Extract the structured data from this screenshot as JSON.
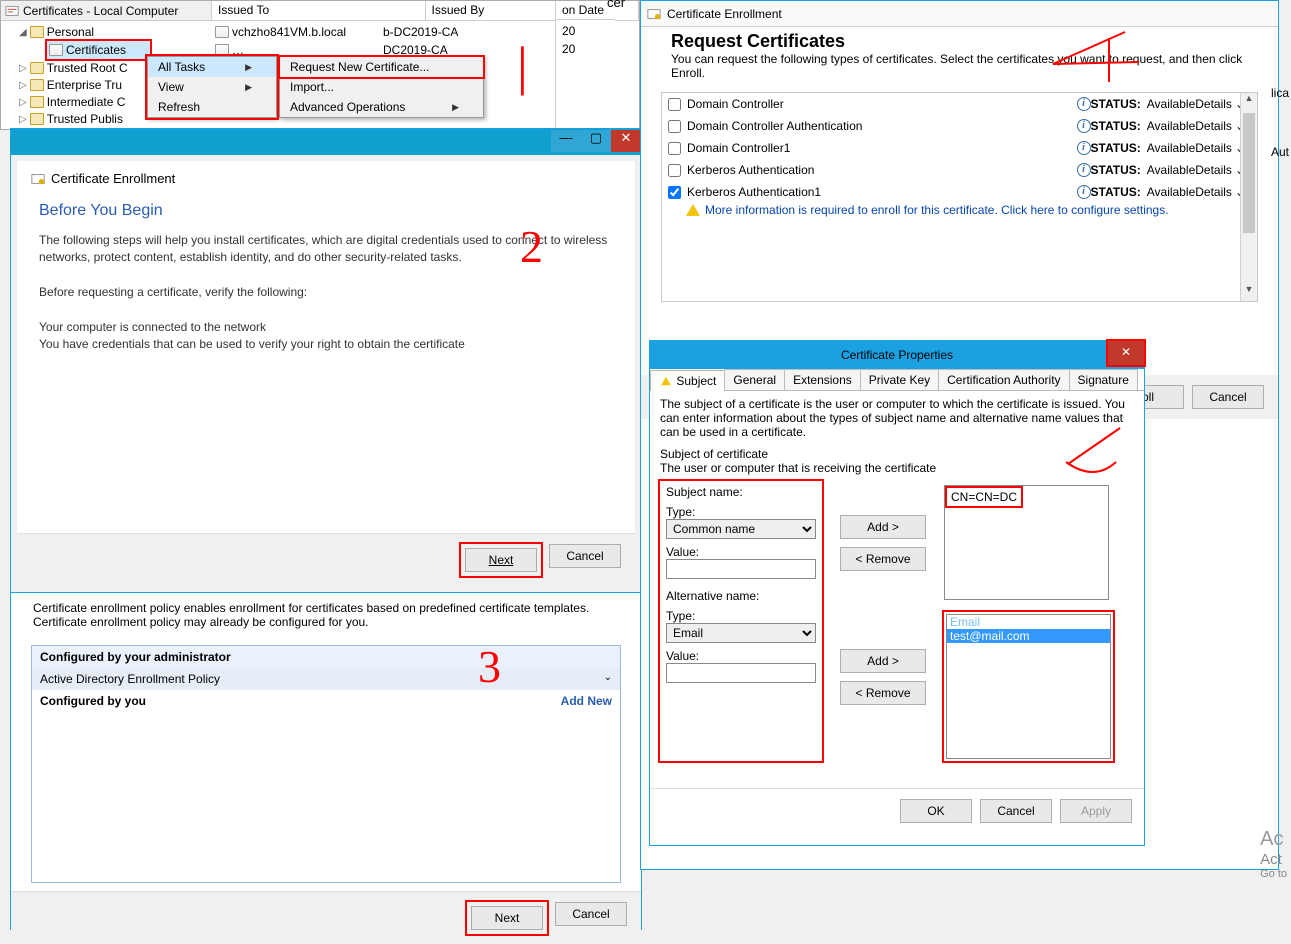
{
  "mmc": {
    "root": "Certificates - Local Computer",
    "personal": "Personal",
    "certificates_node": "Certificates",
    "trusted_root": "Trusted Root C",
    "enterprise": "Enterprise Tru",
    "intermediate": "Intermediate C",
    "trusted_publishers": "Trusted Publis",
    "cols": {
      "issued_to": "Issued To",
      "issued_by": "Issued By",
      "expiration": "on Date"
    },
    "rows": [
      {
        "to": "vchzho841VM.b.local",
        "by": "b-DC2019-CA",
        "exp": "20"
      },
      {
        "to": "…",
        "by": "DC2019-CA",
        "exp": "20"
      }
    ],
    "ctx1": {
      "all_tasks": "All Tasks",
      "view": "View",
      "refresh": "Refresh"
    },
    "ctx2": {
      "request_new": "Request New Certificate...",
      "import": "Import...",
      "advanced": "Advanced Operations"
    },
    "top_cut": "cer"
  },
  "wiz2": {
    "title": "Certificate Enrollment",
    "header": "Before You Begin",
    "p1": "The following steps will help you install certificates, which are digital credentials used to connect to wireless networks, protect content, establish identity, and do other security-related tasks.",
    "p2": "Before requesting a certificate, verify the following:",
    "p3": "Your computer is connected to the network",
    "p4": "You have credentials that can be used to verify your right to obtain the certificate",
    "next": "Next",
    "cancel": "Cancel"
  },
  "wiz3": {
    "intro": "Certificate enrollment policy enables enrollment for certificates based on predefined certificate templates. Certificate enrollment policy may already be configured for you.",
    "configured_admin": "Configured by your administrator",
    "ad_policy": "Active Directory Enrollment Policy",
    "configured_you": "Configured by you",
    "add_new": "Add New",
    "next": "Next",
    "cancel": "Cancel"
  },
  "wiz4": {
    "title": "Certificate Enrollment",
    "header": "Request Certificates",
    "desc": "You can request the following types of certificates. Select the certificates you want to request, and then click Enroll.",
    "status_label": "STATUS:",
    "available": "Available",
    "details": "Details",
    "templates": [
      {
        "name": "Domain Controller",
        "checked": false
      },
      {
        "name": "Domain Controller Authentication",
        "checked": false
      },
      {
        "name": "Domain Controller1",
        "checked": false
      },
      {
        "name": "Kerberos Authentication",
        "checked": false
      },
      {
        "name": "Kerberos Authentication1",
        "checked": true
      }
    ],
    "warn": "More information is required to enroll for this certificate. Click here to configure settings.",
    "enroll": "oll",
    "cancel": "Cancel"
  },
  "wiz5": {
    "title": "Certificate Properties",
    "tabs": [
      "Subject",
      "General",
      "Extensions",
      "Private Key",
      "Certification Authority",
      "Signature"
    ],
    "desc": "The subject of a certificate is the user or computer to which the certificate is issued. You can enter information about the types of subject name and alternative name values that can be used in a certificate.",
    "subj_of_cert": "Subject of certificate",
    "receiving": "The user or computer that is receiving the certificate",
    "subject_name": "Subject name:",
    "alt_name": "Alternative name:",
    "type": "Type:",
    "value": "Value:",
    "subj_type_sel": "Common name",
    "alt_type_sel": "Email",
    "add": "Add >",
    "remove": "< Remove",
    "subj_preview": "CN=CN=DC",
    "alt_preview_label": "Email",
    "alt_preview_value": "test@mail.com",
    "ok": "OK",
    "cancel": "Cancel",
    "apply": "Apply"
  },
  "side_cut": {
    "a": "lica",
    "b": "Aut"
  },
  "activate": {
    "l1": "Ac",
    "l2": "Act",
    "l3": "Go to"
  }
}
